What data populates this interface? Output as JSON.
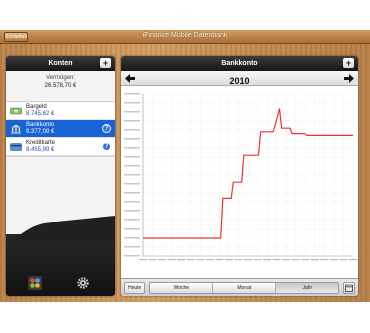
{
  "topbar": {
    "close_label": "Schließen",
    "app_title": "iFinance Mobile Datenbank"
  },
  "accounts_panel": {
    "title": "Konten",
    "add_label": "+",
    "balance_label": "Vermögen:",
    "balance_value": "26.578,70 €",
    "accounts": [
      {
        "name": "Bargeld",
        "amount": "8.745,62 €",
        "icon": "cash-icon",
        "selected": false
      },
      {
        "name": "Bankkonto",
        "amount": "9.377,09 €",
        "icon": "bank-icon",
        "selected": true
      },
      {
        "name": "Kreditkarte",
        "amount": "8.455,99 €",
        "icon": "credit-card-icon",
        "selected": false
      }
    ],
    "info_label": "?"
  },
  "chart_panel": {
    "title": "Bankkonto",
    "add_label": "+",
    "year": "2010"
  },
  "chart_data": {
    "type": "line",
    "x": [
      0,
      0.14,
      0.15,
      0.37,
      0.38,
      0.4,
      0.41,
      0.42,
      0.43,
      0.47,
      0.48,
      0.55,
      0.56,
      0.62,
      0.63,
      0.65,
      0.66,
      0.7,
      0.71,
      0.77,
      0.78,
      1.0
    ],
    "y": [
      1.0,
      1.0,
      1.0,
      1.0,
      3.2,
      3.2,
      3.2,
      3.2,
      4.1,
      4.1,
      5.6,
      5.6,
      6.9,
      6.9,
      7.3,
      8.2,
      7.1,
      7.1,
      6.8,
      6.8,
      6.7,
      6.7
    ],
    "color": "#e8352e",
    "ylim": [
      0,
      9
    ],
    "grid": true
  },
  "segments": {
    "today": "Heute",
    "items": [
      "Woche",
      "Monat",
      "Jahr"
    ],
    "active": "Jahr"
  },
  "colors": {
    "selected_row": "#1a63d6",
    "line": "#e8352e"
  }
}
